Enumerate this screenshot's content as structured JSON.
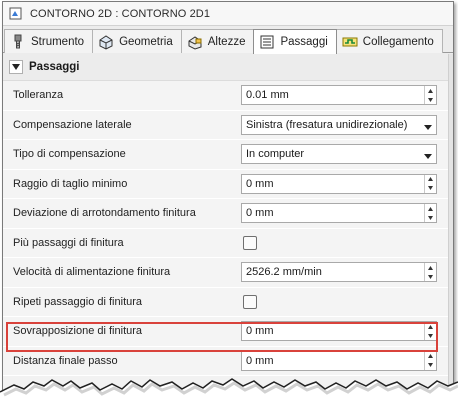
{
  "window": {
    "title": "CONTORNO 2D : CONTORNO 2D1"
  },
  "tabs": [
    {
      "label": "Strumento",
      "icon": "tool-icon",
      "active": false
    },
    {
      "label": "Geometria",
      "icon": "geometry-icon",
      "active": false
    },
    {
      "label": "Altezze",
      "icon": "heights-icon",
      "active": false
    },
    {
      "label": "Passaggi",
      "icon": "passes-icon",
      "active": true
    },
    {
      "label": "Collegamento",
      "icon": "linking-icon",
      "active": false
    }
  ],
  "section": {
    "label": "Passaggi",
    "expanded": true
  },
  "rows": {
    "tolerance": {
      "label": "Tolleranza",
      "value": "0.01 mm"
    },
    "compensation": {
      "label": "Compensazione laterale",
      "value": "Sinistra (fresatura unidirezionale)"
    },
    "compensation_type": {
      "label": "Tipo di compensazione",
      "value": "In computer"
    },
    "min_cut_radius": {
      "label": "Raggio di taglio minimo",
      "value": "0 mm"
    },
    "finish_rounding": {
      "label": "Deviazione di arrotondamento finitura",
      "value": "0 mm"
    },
    "multiple_finish": {
      "label": "Più passaggi di finitura",
      "checked": false
    },
    "finish_feedrate": {
      "label": "Velocità di alimentazione finitura",
      "value": "2526.2 mm/min"
    },
    "repeat_finish": {
      "label": "Ripeti passaggio di finitura",
      "checked": false
    },
    "finish_overlap": {
      "label": "Sovrapposizione di finitura",
      "value": "0 mm"
    },
    "final_step": {
      "label": "Distanza finale passo",
      "value": "0 mm"
    }
  },
  "colors": {
    "highlight": "#d9423b"
  }
}
